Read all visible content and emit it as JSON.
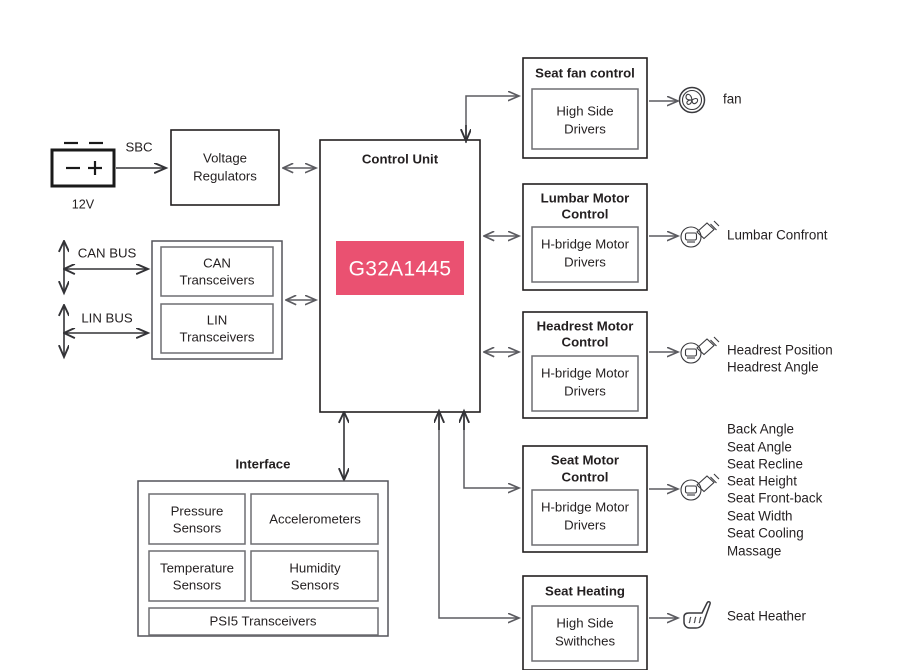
{
  "diagram": {
    "title": "Automotive Seat Control Unit Block Diagram",
    "accent_color": "#ea5171",
    "line_color": "#5b5b60",
    "text_color": "#231f20"
  },
  "power": {
    "battery_label": "12V",
    "battery_icon": "battery-icon",
    "sbc_label": "SBC",
    "regulator_block": {
      "line1": "Voltage",
      "line2": "Regulators"
    }
  },
  "buses": {
    "can_label": "CAN BUS",
    "lin_label": "LIN BUS",
    "can_block": {
      "line1": "CAN",
      "line2": "Transceivers"
    },
    "lin_block": {
      "line1": "LIN",
      "line2": "Transceivers"
    }
  },
  "control_unit": {
    "title": "Control Unit",
    "chip_label": "G32A1445"
  },
  "interface": {
    "title": "Interface",
    "sensors": [
      {
        "line1": "Pressure",
        "line2": "Sensors"
      },
      {
        "line1": "Accelerometers",
        "line2": ""
      },
      {
        "line1": "Temperature",
        "line2": "Sensors"
      },
      {
        "line1": "Humidity",
        "line2": "Sensors"
      }
    ],
    "transceiver": "PSI5 Transceivers"
  },
  "outputs": [
    {
      "name": "seat-fan-control",
      "title": "Seat fan control",
      "driver_line1": "High Side",
      "driver_line2": "Drivers",
      "icon": "fan-icon",
      "loads": [
        "fan"
      ]
    },
    {
      "name": "lumbar-motor-control",
      "title_line1": "Lumbar Motor",
      "title_line2": "Control",
      "driver_line1": "H-bridge Motor",
      "driver_line2": "Drivers",
      "icon": "motor-icon",
      "loads": [
        "Lumbar Confront"
      ]
    },
    {
      "name": "headrest-motor-control",
      "title_line1": "Headrest Motor",
      "title_line2": "Control",
      "driver_line1": "H-bridge Motor",
      "driver_line2": "Drivers",
      "icon": "motor-icon",
      "loads": [
        "Headrest Position",
        "Headrest Angle"
      ]
    },
    {
      "name": "seat-motor-control",
      "title_line1": "Seat Motor",
      "title_line2": "Control",
      "driver_line1": "H-bridge Motor",
      "driver_line2": "Drivers",
      "icon": "motor-icon",
      "loads": [
        "Back Angle",
        "Seat Angle",
        "Seat Recline",
        "Seat Height",
        "Seat Front-back",
        "Seat Width",
        "Seat Cooling",
        "Massage"
      ]
    },
    {
      "name": "seat-heating",
      "title": "Seat Heating",
      "driver_line1": "High Side",
      "driver_line2": "Swithches",
      "icon": "seat-heater-icon",
      "loads": [
        "Seat Heather"
      ]
    }
  ]
}
